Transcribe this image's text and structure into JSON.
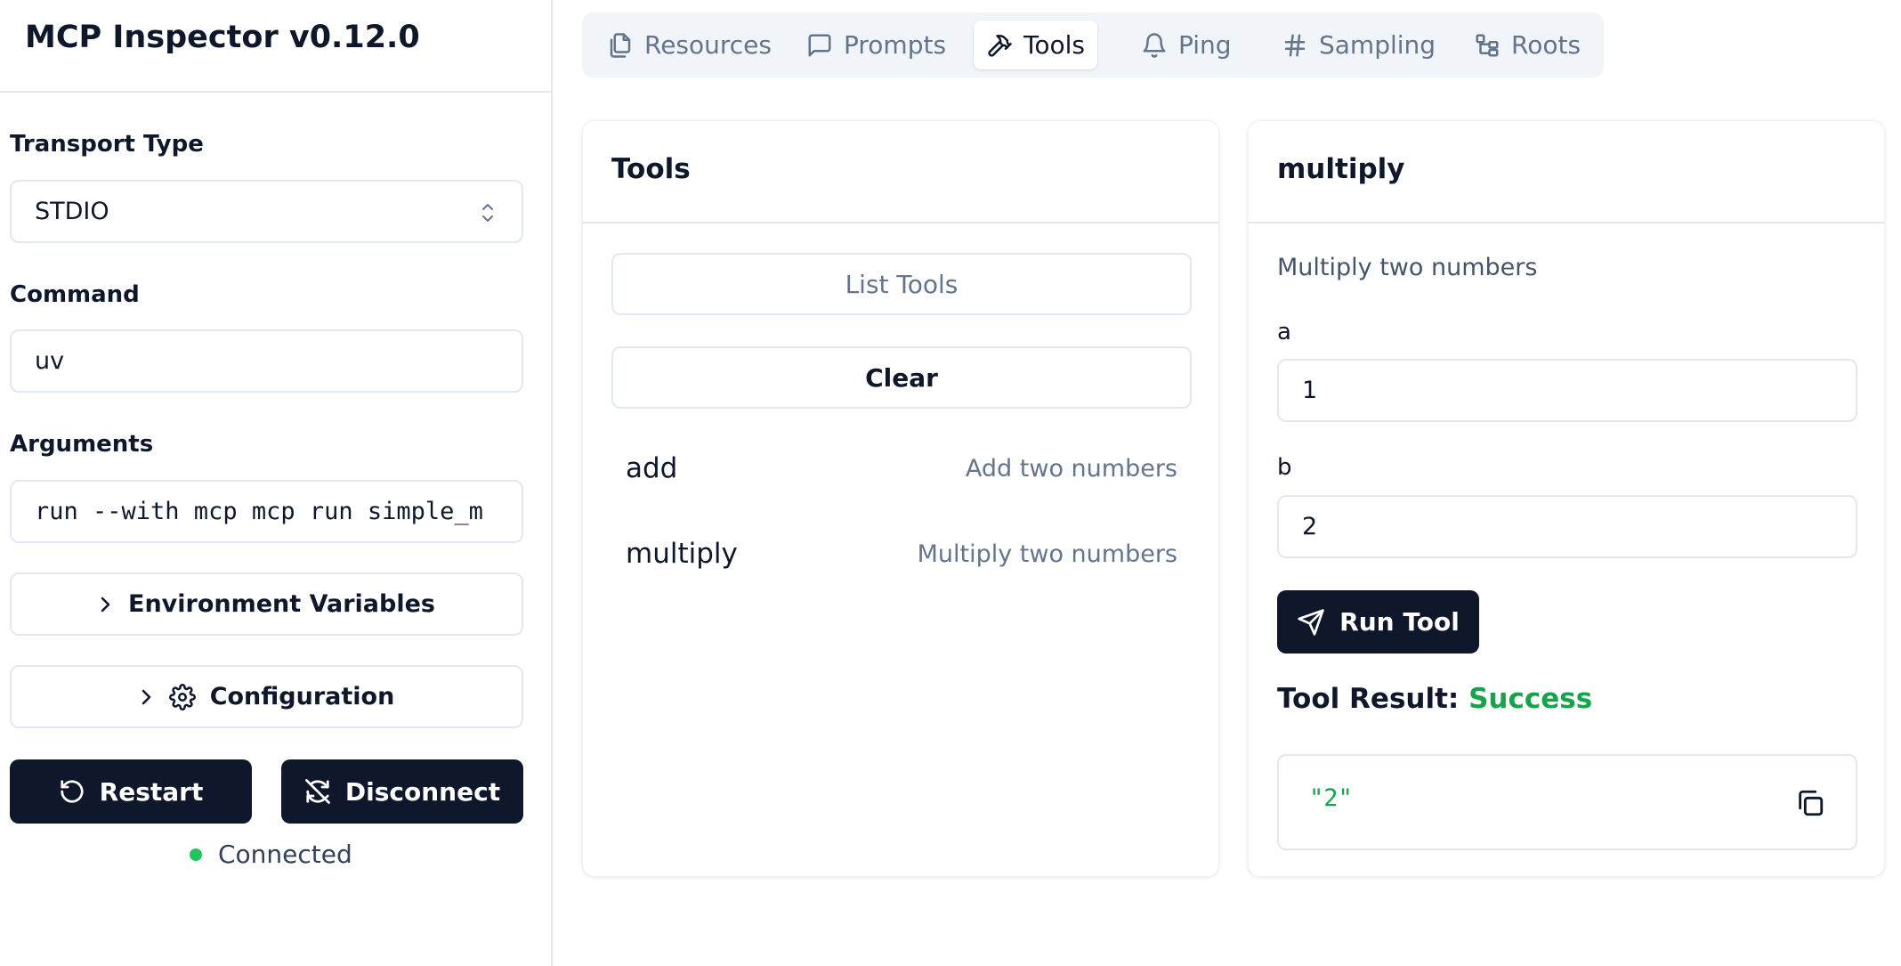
{
  "app": {
    "title": "MCP Inspector v0.12.0"
  },
  "sidebar": {
    "transport_label": "Transport Type",
    "transport_value": "STDIO",
    "command_label": "Command",
    "command_value": "uv",
    "arguments_label": "Arguments",
    "arguments_value": "run --with mcp mcp run simple_m",
    "env_label": "Environment Variables",
    "config_label": "Configuration",
    "restart_label": "Restart",
    "disconnect_label": "Disconnect",
    "status_text": "Connected",
    "status_color": "#22c55e"
  },
  "tabs": [
    {
      "label": "Resources",
      "icon": "files-icon"
    },
    {
      "label": "Prompts",
      "icon": "message-square-icon"
    },
    {
      "label": "Tools",
      "icon": "hammer-icon",
      "active": true
    },
    {
      "label": "Ping",
      "icon": "bell-icon"
    },
    {
      "label": "Sampling",
      "icon": "hash-icon"
    },
    {
      "label": "Roots",
      "icon": "folder-tree-icon"
    }
  ],
  "tools_panel": {
    "title": "Tools",
    "list_button": "List Tools",
    "clear_button": "Clear",
    "items": [
      {
        "name": "add",
        "description": "Add two numbers"
      },
      {
        "name": "multiply",
        "description": "Multiply two numbers"
      }
    ]
  },
  "tool_detail": {
    "title": "multiply",
    "description": "Multiply two numbers",
    "params": [
      {
        "label": "a",
        "value": "1"
      },
      {
        "label": "b",
        "value": "2"
      }
    ],
    "run_button": "Run Tool",
    "result_label": "Tool Result:",
    "result_status": "Success",
    "result_status_color": "#16a34a",
    "result_value": "\"2\""
  }
}
